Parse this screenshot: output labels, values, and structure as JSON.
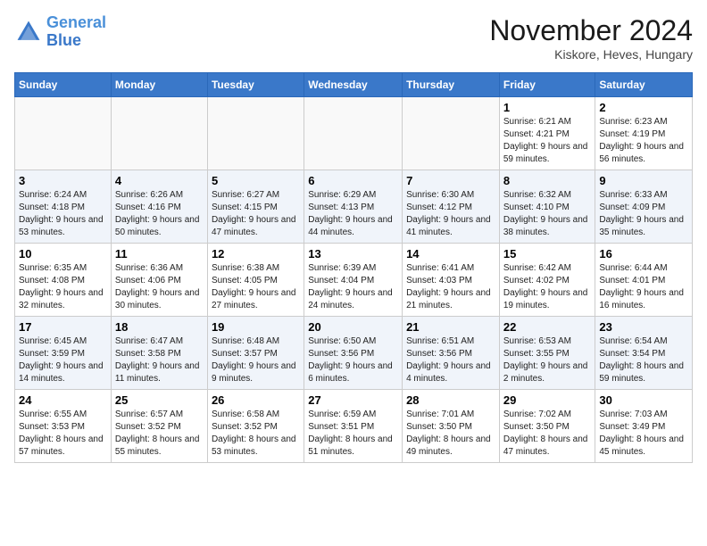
{
  "logo": {
    "line1": "General",
    "line2": "Blue"
  },
  "title": "November 2024",
  "location": "Kiskore, Heves, Hungary",
  "days_of_week": [
    "Sunday",
    "Monday",
    "Tuesday",
    "Wednesday",
    "Thursday",
    "Friday",
    "Saturday"
  ],
  "weeks": [
    [
      {
        "day": "",
        "info": ""
      },
      {
        "day": "",
        "info": ""
      },
      {
        "day": "",
        "info": ""
      },
      {
        "day": "",
        "info": ""
      },
      {
        "day": "",
        "info": ""
      },
      {
        "day": "1",
        "info": "Sunrise: 6:21 AM\nSunset: 4:21 PM\nDaylight: 9 hours and 59 minutes."
      },
      {
        "day": "2",
        "info": "Sunrise: 6:23 AM\nSunset: 4:19 PM\nDaylight: 9 hours and 56 minutes."
      }
    ],
    [
      {
        "day": "3",
        "info": "Sunrise: 6:24 AM\nSunset: 4:18 PM\nDaylight: 9 hours and 53 minutes."
      },
      {
        "day": "4",
        "info": "Sunrise: 6:26 AM\nSunset: 4:16 PM\nDaylight: 9 hours and 50 minutes."
      },
      {
        "day": "5",
        "info": "Sunrise: 6:27 AM\nSunset: 4:15 PM\nDaylight: 9 hours and 47 minutes."
      },
      {
        "day": "6",
        "info": "Sunrise: 6:29 AM\nSunset: 4:13 PM\nDaylight: 9 hours and 44 minutes."
      },
      {
        "day": "7",
        "info": "Sunrise: 6:30 AM\nSunset: 4:12 PM\nDaylight: 9 hours and 41 minutes."
      },
      {
        "day": "8",
        "info": "Sunrise: 6:32 AM\nSunset: 4:10 PM\nDaylight: 9 hours and 38 minutes."
      },
      {
        "day": "9",
        "info": "Sunrise: 6:33 AM\nSunset: 4:09 PM\nDaylight: 9 hours and 35 minutes."
      }
    ],
    [
      {
        "day": "10",
        "info": "Sunrise: 6:35 AM\nSunset: 4:08 PM\nDaylight: 9 hours and 32 minutes."
      },
      {
        "day": "11",
        "info": "Sunrise: 6:36 AM\nSunset: 4:06 PM\nDaylight: 9 hours and 30 minutes."
      },
      {
        "day": "12",
        "info": "Sunrise: 6:38 AM\nSunset: 4:05 PM\nDaylight: 9 hours and 27 minutes."
      },
      {
        "day": "13",
        "info": "Sunrise: 6:39 AM\nSunset: 4:04 PM\nDaylight: 9 hours and 24 minutes."
      },
      {
        "day": "14",
        "info": "Sunrise: 6:41 AM\nSunset: 4:03 PM\nDaylight: 9 hours and 21 minutes."
      },
      {
        "day": "15",
        "info": "Sunrise: 6:42 AM\nSunset: 4:02 PM\nDaylight: 9 hours and 19 minutes."
      },
      {
        "day": "16",
        "info": "Sunrise: 6:44 AM\nSunset: 4:01 PM\nDaylight: 9 hours and 16 minutes."
      }
    ],
    [
      {
        "day": "17",
        "info": "Sunrise: 6:45 AM\nSunset: 3:59 PM\nDaylight: 9 hours and 14 minutes."
      },
      {
        "day": "18",
        "info": "Sunrise: 6:47 AM\nSunset: 3:58 PM\nDaylight: 9 hours and 11 minutes."
      },
      {
        "day": "19",
        "info": "Sunrise: 6:48 AM\nSunset: 3:57 PM\nDaylight: 9 hours and 9 minutes."
      },
      {
        "day": "20",
        "info": "Sunrise: 6:50 AM\nSunset: 3:56 PM\nDaylight: 9 hours and 6 minutes."
      },
      {
        "day": "21",
        "info": "Sunrise: 6:51 AM\nSunset: 3:56 PM\nDaylight: 9 hours and 4 minutes."
      },
      {
        "day": "22",
        "info": "Sunrise: 6:53 AM\nSunset: 3:55 PM\nDaylight: 9 hours and 2 minutes."
      },
      {
        "day": "23",
        "info": "Sunrise: 6:54 AM\nSunset: 3:54 PM\nDaylight: 8 hours and 59 minutes."
      }
    ],
    [
      {
        "day": "24",
        "info": "Sunrise: 6:55 AM\nSunset: 3:53 PM\nDaylight: 8 hours and 57 minutes."
      },
      {
        "day": "25",
        "info": "Sunrise: 6:57 AM\nSunset: 3:52 PM\nDaylight: 8 hours and 55 minutes."
      },
      {
        "day": "26",
        "info": "Sunrise: 6:58 AM\nSunset: 3:52 PM\nDaylight: 8 hours and 53 minutes."
      },
      {
        "day": "27",
        "info": "Sunrise: 6:59 AM\nSunset: 3:51 PM\nDaylight: 8 hours and 51 minutes."
      },
      {
        "day": "28",
        "info": "Sunrise: 7:01 AM\nSunset: 3:50 PM\nDaylight: 8 hours and 49 minutes."
      },
      {
        "day": "29",
        "info": "Sunrise: 7:02 AM\nSunset: 3:50 PM\nDaylight: 8 hours and 47 minutes."
      },
      {
        "day": "30",
        "info": "Sunrise: 7:03 AM\nSunset: 3:49 PM\nDaylight: 8 hours and 45 minutes."
      }
    ]
  ]
}
